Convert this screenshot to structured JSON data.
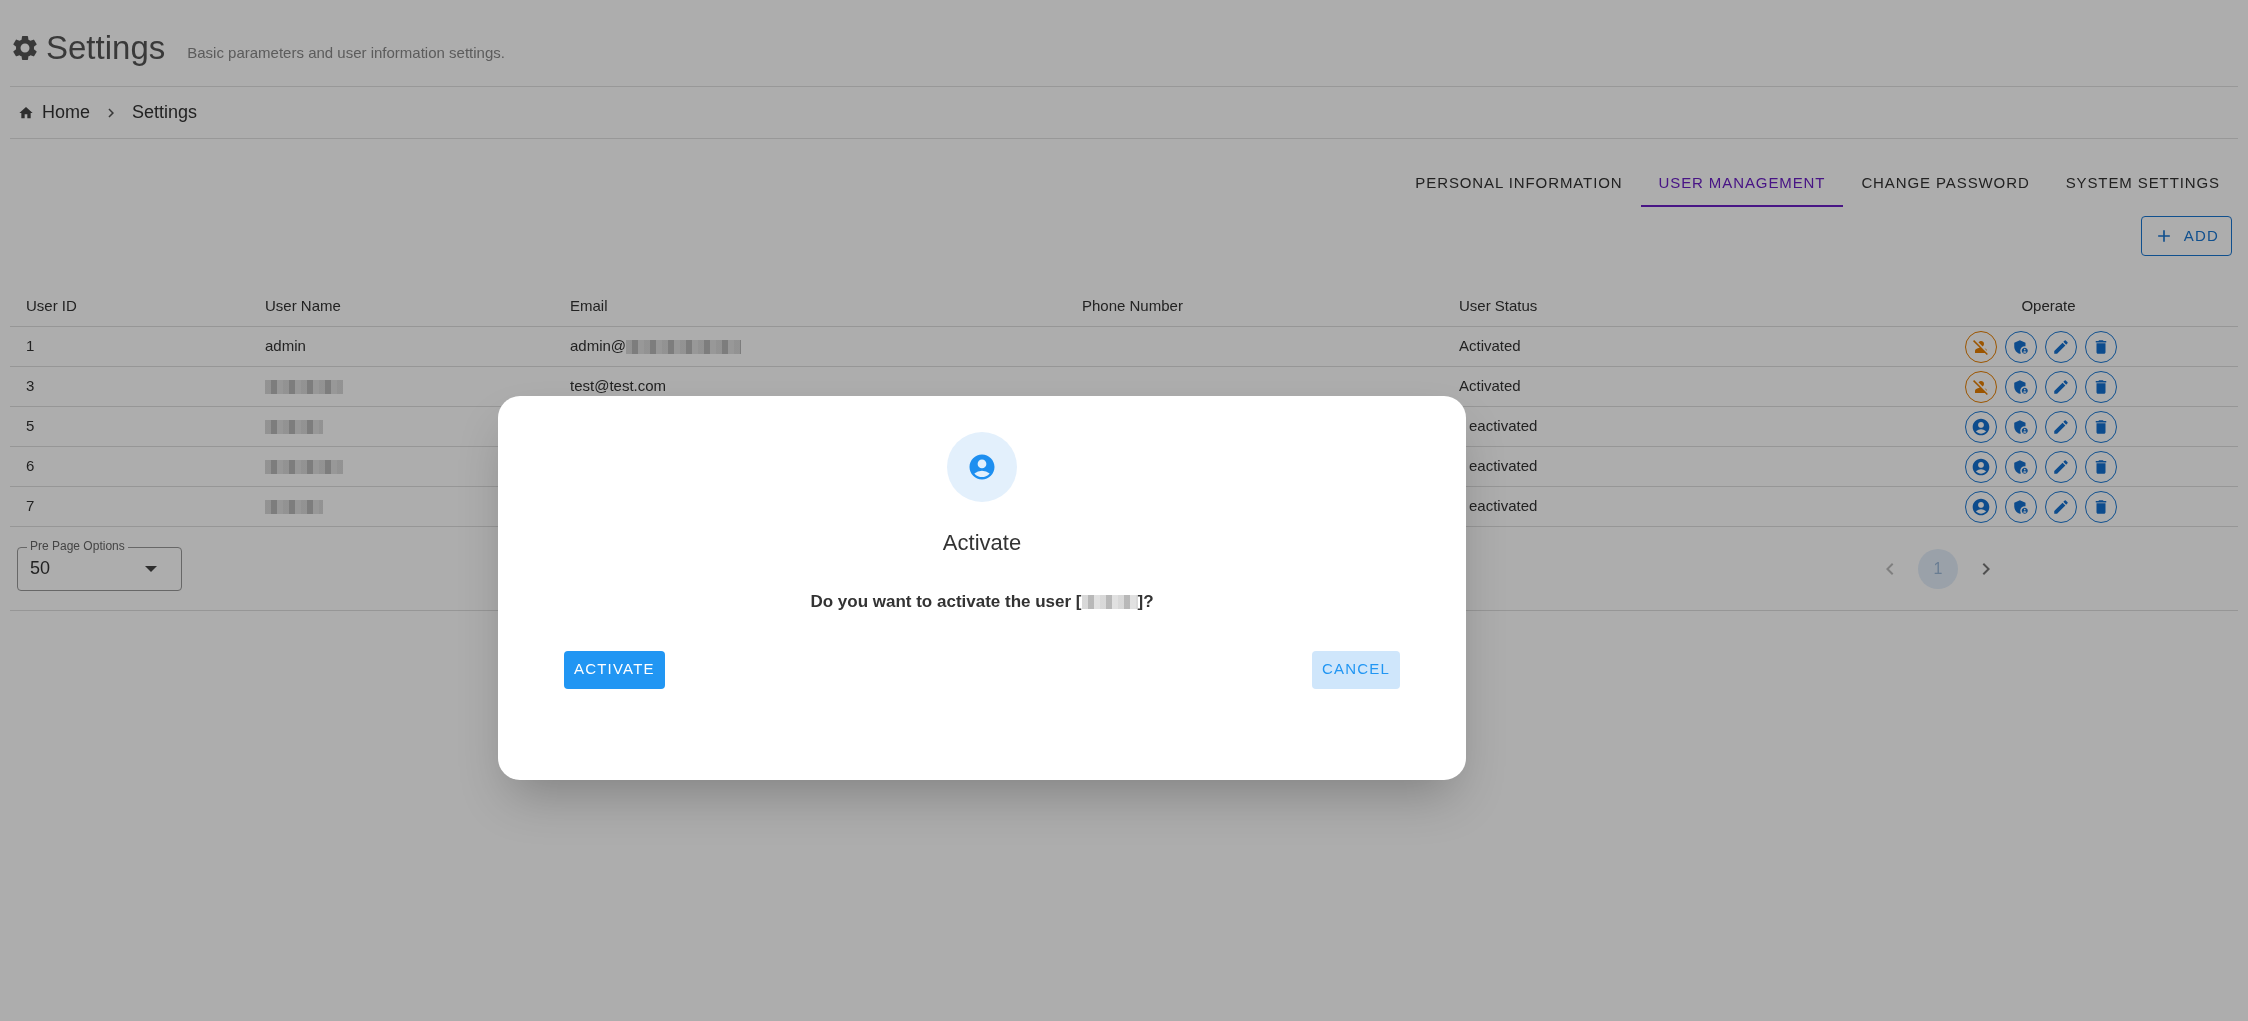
{
  "header": {
    "title": "Settings",
    "subtitle": "Basic parameters and user information settings."
  },
  "breadcrumb": [
    "Home",
    "Settings"
  ],
  "tabs": [
    {
      "label": "PERSONAL INFORMATION",
      "selected": false
    },
    {
      "label": "USER MANAGEMENT",
      "selected": true
    },
    {
      "label": "CHANGE PASSWORD",
      "selected": false
    },
    {
      "label": "SYSTEM SETTINGS",
      "selected": false
    }
  ],
  "add_button": "ADD",
  "table": {
    "columns": [
      "User ID",
      "User Name",
      "Email",
      "Phone Number",
      "User Status",
      "Operate"
    ],
    "rows": [
      {
        "id": "1",
        "name": "admin",
        "email": "admin@",
        "email_redacted": true,
        "status": "Activated",
        "activated": true
      },
      {
        "id": "3",
        "name_redacted": true,
        "email": "test@test.com",
        "status": "Activated",
        "activated": true
      },
      {
        "id": "5",
        "name_redacted": true,
        "status": "eactivated",
        "activated": false
      },
      {
        "id": "6",
        "name_redacted": true,
        "status": "eactivated",
        "activated": false
      },
      {
        "id": "7",
        "name_redacted": true,
        "status": "eactivated",
        "activated": false
      }
    ]
  },
  "per_page": {
    "label": "Pre Page Options",
    "value": "50"
  },
  "pagination": {
    "pages": [
      {
        "label": "1",
        "selected": true
      }
    ]
  },
  "dialog": {
    "title": "Activate",
    "message_before": "Do you want to activate the user [",
    "message_after": "]?",
    "confirm": "ACTIVATE",
    "cancel": "CANCEL"
  }
}
